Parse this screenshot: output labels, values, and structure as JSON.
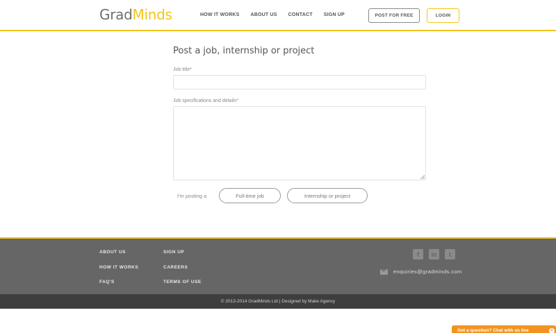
{
  "header": {
    "logo_part1": "Grad",
    "logo_part2": "Minds",
    "nav": [
      "HOW IT WORKS",
      "ABOUT US",
      "CONTACT",
      "SIGN UP"
    ],
    "post_button": "POST FOR FREE",
    "login_button": "LOGIN",
    "accent_color": "#f2c51a"
  },
  "form": {
    "title": "Post a job, internship or project",
    "job_title_label": "Job title*",
    "job_title_value": "",
    "spec_label": "Job specifications and details*",
    "spec_value": "",
    "posting_label": "I'm posting a",
    "options": [
      "Full-time job",
      "Internship or project"
    ]
  },
  "footer": {
    "col1": [
      "ABOUT US",
      "HOW IT WORKS",
      "FAQ'S"
    ],
    "col2": [
      "SIGN UP",
      "CAREERS",
      "TERMS OF USE"
    ],
    "social_icons": [
      "facebook-icon",
      "linkedin-icon",
      "twitter-icon"
    ],
    "email": "enquiries@gradminds.com",
    "copyright": "© 2013-2014 GradMinds Ltd | Designed by Make Agency"
  },
  "chat": {
    "label": "Got a question? Chat with us live",
    "color": "#f29321"
  }
}
